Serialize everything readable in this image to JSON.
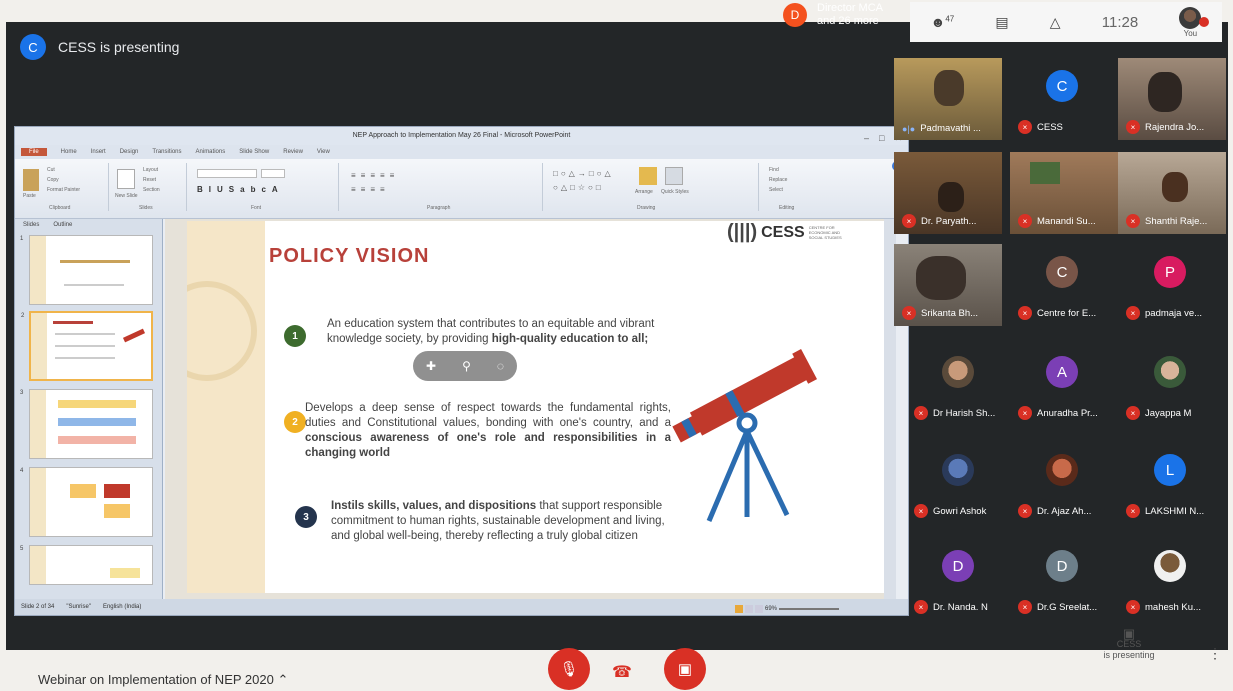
{
  "meeting": {
    "presenting_banner": "CESS is presenting",
    "presenter_initial": "C",
    "top_speaker": {
      "initial": "D",
      "name": "Director MCA",
      "more": "and 26 more"
    },
    "participants_count": "47",
    "time": "11:28",
    "you_label": "You",
    "title": "Webinar on Implementation of NEP 2020",
    "presenting_tile": {
      "line1": "CESS",
      "line2": "is presenting"
    }
  },
  "powerpoint": {
    "window_title": "NEP Approach to Implementation May 26 Final - Microsoft PowerPoint",
    "tabs": [
      "File",
      "Home",
      "Insert",
      "Design",
      "Transitions",
      "Animations",
      "Slide Show",
      "Review",
      "View"
    ],
    "ribbon": {
      "clipboard": [
        "Cut",
        "Copy",
        "Format Painter",
        "Paste"
      ],
      "slides": [
        "Layout",
        "Reset",
        "Section",
        "New Slide"
      ],
      "editing": [
        "Find",
        "Replace",
        "Select"
      ],
      "arrange_label": "Arrange",
      "quick_styles_label": "Quick Styles",
      "group_labels": [
        "Clipboard",
        "Slides",
        "Font",
        "Paragraph",
        "Drawing",
        "Editing"
      ]
    },
    "panel_tabs": [
      "Slides",
      "Outline"
    ],
    "status": [
      "Slide 2 of 34",
      "\"Sunrise\"",
      "English (India)"
    ],
    "zoom": "69%"
  },
  "slide": {
    "title": "POLICY VISION",
    "logo_text": "CESS",
    "logo_sub": "CENTRE FOR ECONOMIC AND SOCIAL STUDIES",
    "points": [
      {
        "num": "1",
        "color": "#3d6b2e",
        "text": "An education system that contributes to an equitable and vibrant knowledge society, by providing",
        "bold": "high-quality education to all;"
      },
      {
        "num": "2",
        "color": "#f0b022",
        "text": "Develops a deep sense of respect towards the fundamental rights, duties and Constitutional values, bonding with one's country, and a",
        "bold": "conscious awareness of one's role and responsibilities in a changing world"
      },
      {
        "num": "3",
        "color": "#24344d",
        "bold": "Instils skills, values, and dispositions",
        "text": "that support responsible commitment to human rights, sustainable development and living, and global well-being, thereby reflecting a truly global citizen"
      }
    ]
  },
  "participants": [
    {
      "name": "Padmavathi ...",
      "initial": "",
      "color": "",
      "video": true
    },
    {
      "name": "CESS",
      "initial": "C",
      "color": "#1a73e8",
      "video": false
    },
    {
      "name": "Rajendra Jo...",
      "initial": "",
      "color": "",
      "video": true
    },
    {
      "name": "Dr. Paryath...",
      "initial": "",
      "color": "",
      "video": true
    },
    {
      "name": "Manandi Su...",
      "initial": "",
      "color": "",
      "video": true
    },
    {
      "name": "Shanthi Raje...",
      "initial": "",
      "color": "",
      "video": true
    },
    {
      "name": "Srikanta Bh...",
      "initial": "",
      "color": "",
      "video": true
    },
    {
      "name": "Centre for E...",
      "initial": "C",
      "color": "#795548",
      "video": false
    },
    {
      "name": "padmaja ve...",
      "initial": "P",
      "color": "#d81b60",
      "video": false
    },
    {
      "name": "Dr Harish Sh...",
      "initial": "",
      "color": "",
      "video": false
    },
    {
      "name": "Anuradha Pr...",
      "initial": "A",
      "color": "#7b3fb5",
      "video": false
    },
    {
      "name": "Jayappa M",
      "initial": "",
      "color": "",
      "video": false
    },
    {
      "name": "Gowri Ashok",
      "initial": "",
      "color": "",
      "video": false
    },
    {
      "name": "Dr. Ajaz Ah...",
      "initial": "",
      "color": "",
      "video": false
    },
    {
      "name": "LAKSHMI N...",
      "initial": "L",
      "color": "#1a73e8",
      "video": false
    },
    {
      "name": "Dr. Nanda. N",
      "initial": "D",
      "color": "#7b3fb5",
      "video": false
    },
    {
      "name": "Dr.G Sreelat...",
      "initial": "D",
      "color": "#6d7f8a",
      "video": false
    },
    {
      "name": "mahesh Ku...",
      "initial": "",
      "color": "",
      "video": false
    }
  ]
}
